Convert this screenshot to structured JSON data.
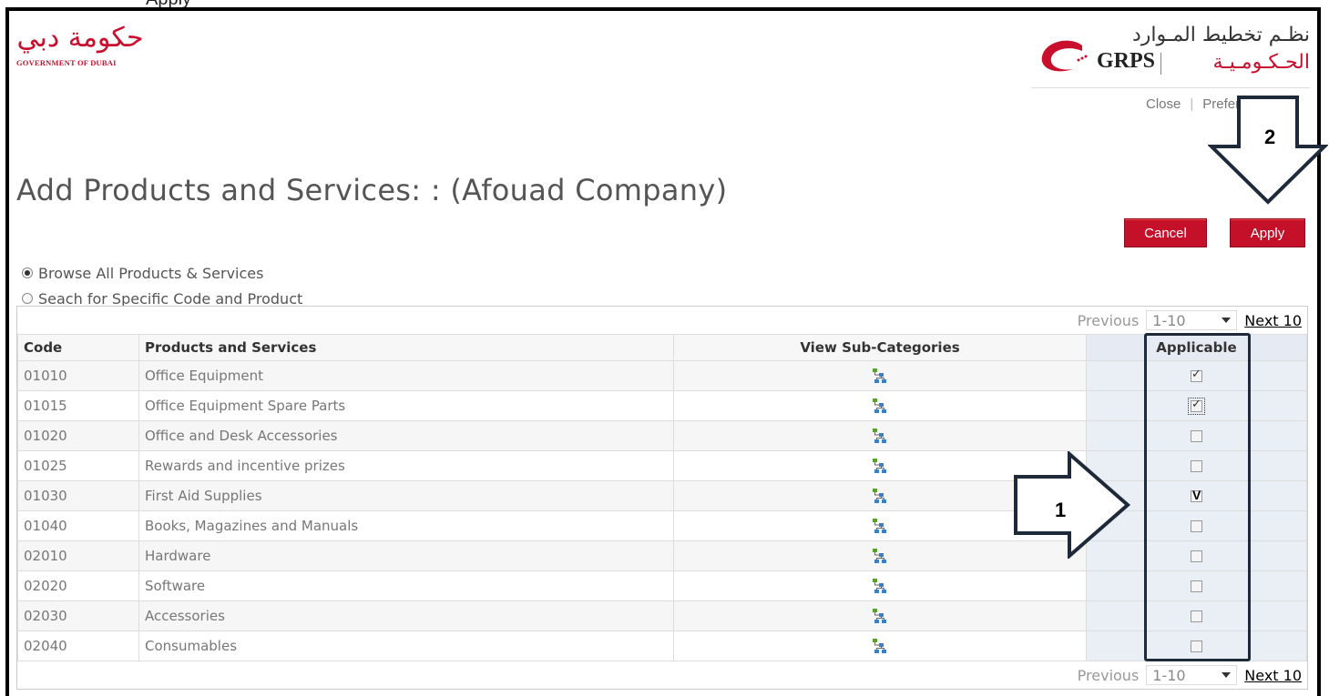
{
  "top_fragment": "Apply",
  "logos": {
    "dubai_script": "حكومة دبي",
    "dubai_caption": "GOVERNMENT OF DUBAI",
    "grps_arabic_line1": "نظـم تخطيط المـوارد",
    "grps_arabic_line2": "الحـكـومـيـة",
    "grps_english": "GRPS"
  },
  "toplinks": {
    "close": "Close",
    "separator": "|",
    "preferences": "Preferences"
  },
  "title": "Add Products and Services: : (Afouad Company)",
  "buttons": {
    "cancel": "Cancel",
    "apply": "Apply"
  },
  "radios": {
    "browse": "Browse All Products & Services",
    "search": "Seach for Specific Code and Product",
    "selected": "browse"
  },
  "pager": {
    "previous": "Previous",
    "range": "1-10",
    "next": "Next 10"
  },
  "table": {
    "headers": {
      "code": "Code",
      "name": "Products and Services",
      "sub": "View Sub-Categories",
      "applicable": "Applicable"
    },
    "rows": [
      {
        "code": "01010",
        "name": "Office Equipment",
        "checked": true
      },
      {
        "code": "01015",
        "name": "Office Equipment Spare Parts",
        "checked": true,
        "focus": true
      },
      {
        "code": "01020",
        "name": "Office and Desk Accessories",
        "checked": false
      },
      {
        "code": "01025",
        "name": "Rewards and incentive prizes",
        "checked": false
      },
      {
        "code": "01030",
        "name": "First Aid Supplies",
        "checked": false,
        "mark": "V"
      },
      {
        "code": "01040",
        "name": "Books, Magazines and Manuals",
        "checked": false
      },
      {
        "code": "02010",
        "name": "Hardware",
        "checked": false
      },
      {
        "code": "02020",
        "name": "Software",
        "checked": false
      },
      {
        "code": "02030",
        "name": "Accessories",
        "checked": false
      },
      {
        "code": "02040",
        "name": "Consumables",
        "checked": false
      }
    ]
  },
  "annotations": {
    "step1": "1",
    "step2": "2"
  },
  "colors": {
    "brand_red": "#c5102a",
    "annotation_navy": "#1e2a3a",
    "highlight_bg": "#eaeef5"
  }
}
